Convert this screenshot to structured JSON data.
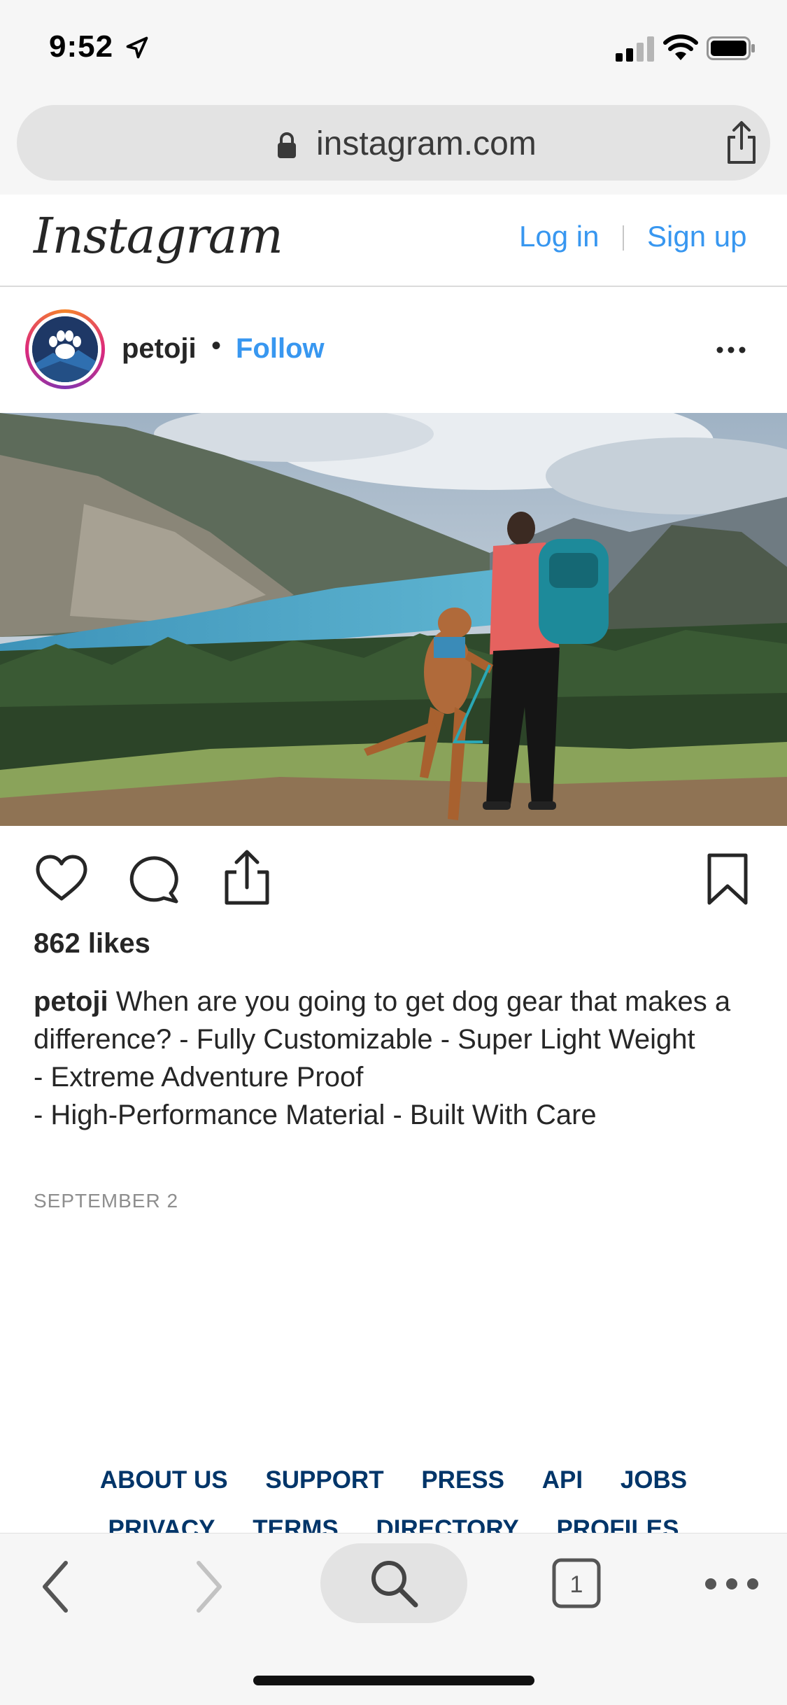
{
  "status_bar": {
    "time": "9:52"
  },
  "browser": {
    "url": "instagram.com"
  },
  "header": {
    "logo": "Instagram",
    "login": "Log in",
    "signup": "Sign up"
  },
  "post": {
    "username": "petoji",
    "dot": "•",
    "follow": "Follow",
    "likes": "862 likes",
    "caption_user": "petoji",
    "caption_text": "When are you going to get dog gear that makes a difference? - Fully Customizable - Super Light Weight\n- Extreme Adventure Proof\n- High-Performance Material - Built With Care",
    "date": "SEPTEMBER 2"
  },
  "footer": {
    "row1": [
      "ABOUT US",
      "SUPPORT",
      "PRESS",
      "API",
      "JOBS"
    ],
    "row2": [
      "PRIVACY",
      "TERMS",
      "DIRECTORY",
      "PROFILES"
    ]
  },
  "toolbar": {
    "tab_count": "1"
  },
  "colors": {
    "link": "#3897f0",
    "footer_link": "#003569",
    "text": "#262626",
    "muted": "#8e8e8e"
  }
}
